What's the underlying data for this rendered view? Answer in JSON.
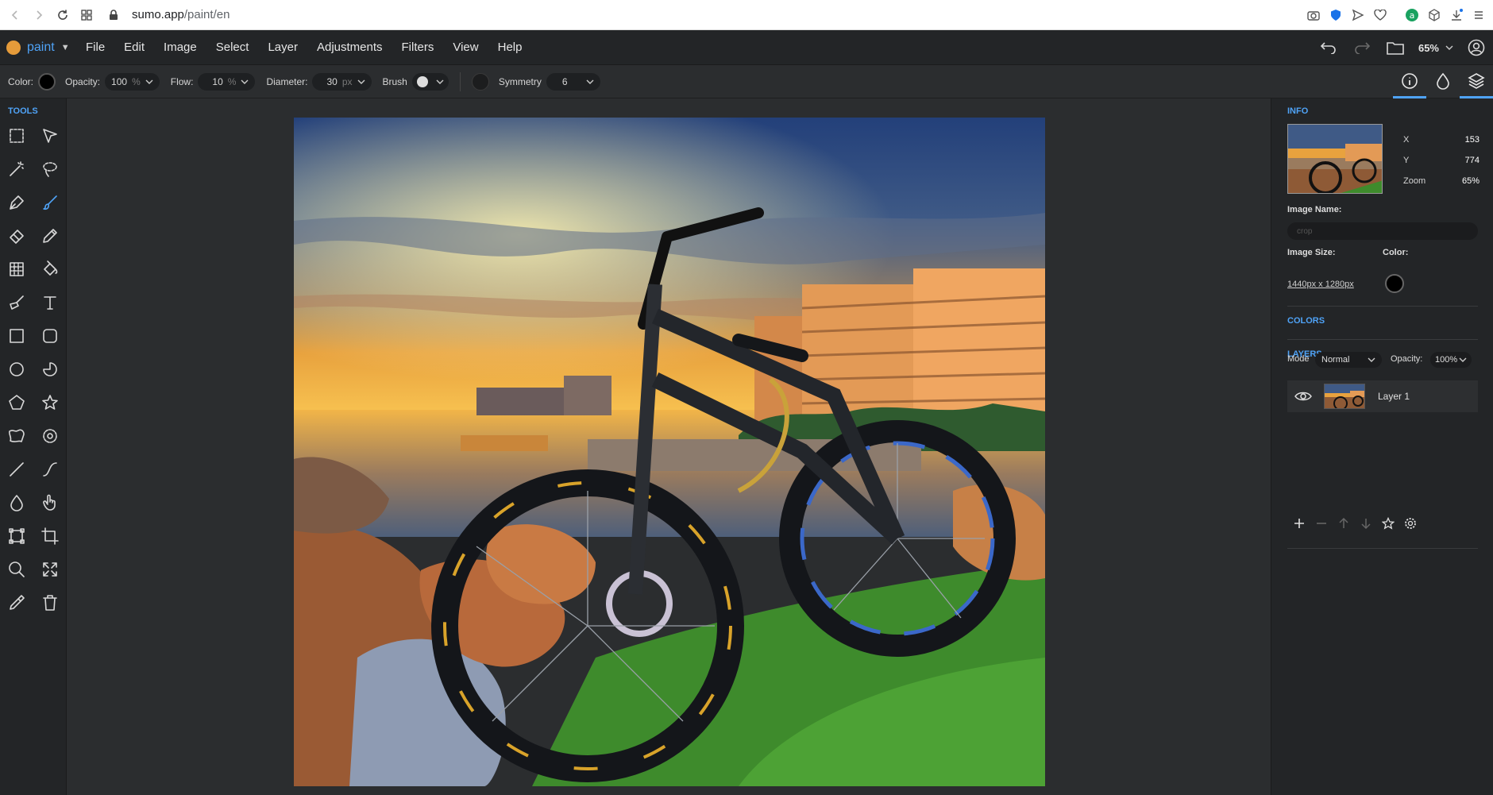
{
  "browser": {
    "url_host": "sumo.app",
    "url_path": "/paint/en"
  },
  "app": {
    "logo_label": "paint",
    "menu": [
      "File",
      "Edit",
      "Image",
      "Select",
      "Layer",
      "Adjustments",
      "Filters",
      "View",
      "Help"
    ],
    "zoom_label": "65%"
  },
  "options": {
    "color_label": "Color:",
    "opacity_label": "Opacity:",
    "opacity_value": "100",
    "opacity_unit": "%",
    "flow_label": "Flow:",
    "flow_value": "10",
    "flow_unit": "%",
    "diameter_label": "Diameter:",
    "diameter_value": "30",
    "diameter_unit": "px",
    "brush_label": "Brush",
    "symmetry_label": "Symmetry",
    "symmetry_value": "6",
    "current_color": "#000000"
  },
  "tools": {
    "title": "TOOLS",
    "items": [
      "rect-select-icon",
      "path-select-icon",
      "magic-wand-icon",
      "lasso-icon",
      "pen-icon",
      "brush-icon",
      "eraser-icon",
      "pencil-icon",
      "gradient-icon",
      "fill-icon",
      "smudge-icon",
      "text-icon",
      "rectangle-icon",
      "rounded-rect-icon",
      "ellipse-icon",
      "pie-icon",
      "polygon-icon",
      "star-icon",
      "shape-icon",
      "gear-shape-icon",
      "line-icon",
      "curve-icon",
      "drop-icon",
      "hand-icon",
      "transform-icon",
      "crop-icon",
      "zoom-icon",
      "fit-icon",
      "picker-icon",
      "trash-icon"
    ],
    "active": "brush-icon"
  },
  "info": {
    "title": "INFO",
    "x_label": "X",
    "x_value": "153",
    "y_label": "Y",
    "y_value": "774",
    "zoom_label": "Zoom",
    "zoom_value": "65%",
    "image_name_label": "Image Name:",
    "image_name_value": "crop",
    "image_size_label": "Image Size:",
    "image_size_value": "1440px x 1280px",
    "color_label": "Color:"
  },
  "colors": {
    "title": "COLORS"
  },
  "layers": {
    "title": "LAYERS",
    "mode_label": "Mode",
    "mode_value": "Normal",
    "opacity_label": "Opacity:",
    "opacity_value": "100%",
    "items": [
      {
        "name": "Layer 1"
      }
    ]
  },
  "theme": {
    "accent": "#4fa3f7"
  }
}
